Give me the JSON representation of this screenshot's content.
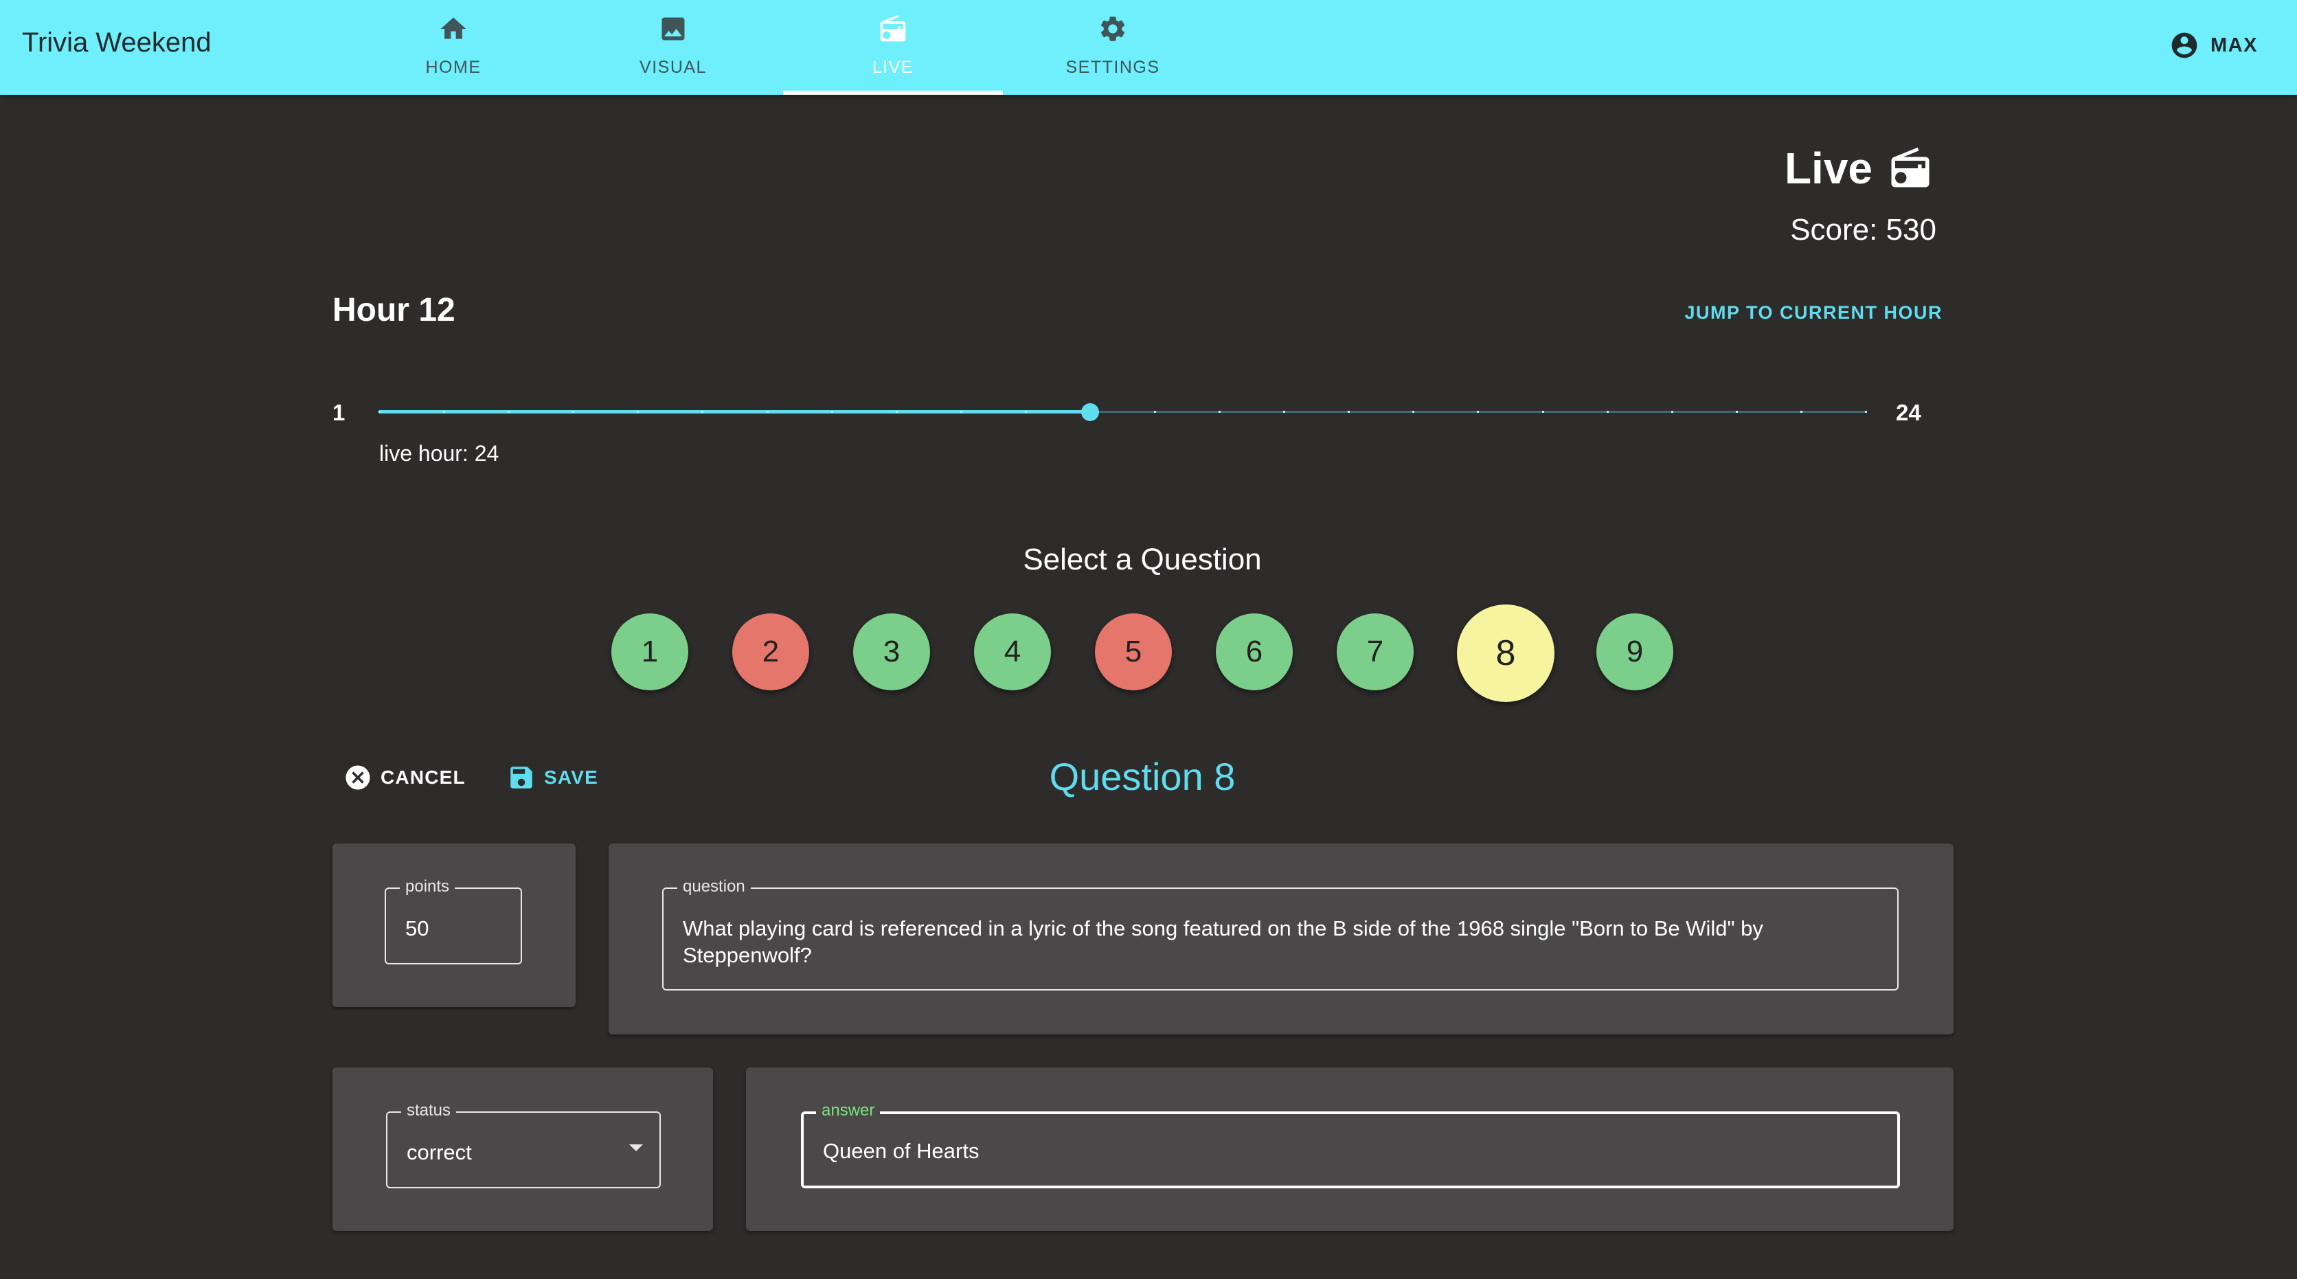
{
  "app": {
    "title": "Trivia Weekend"
  },
  "nav": {
    "tabs": [
      {
        "label": "HOME",
        "icon": "home-icon"
      },
      {
        "label": "VISUAL",
        "icon": "image-icon"
      },
      {
        "label": "LIVE",
        "icon": "radio-icon",
        "active": true
      },
      {
        "label": "SETTINGS",
        "icon": "gear-icon"
      }
    ],
    "user": {
      "label": "MAX",
      "icon": "account-circle-icon"
    }
  },
  "live": {
    "title": "Live",
    "icon": "radio-icon",
    "score_text": "Score: 530"
  },
  "hour": {
    "title": "Hour 12",
    "jump_label": "JUMP TO CURRENT HOUR",
    "slider": {
      "min_label": "1",
      "max_label": "24",
      "min": 1,
      "max": 24,
      "value": 12
    },
    "live_hour_note": "live hour: 24"
  },
  "questions": {
    "title": "Select a Question",
    "items": [
      {
        "label": "1",
        "status": "correct"
      },
      {
        "label": "2",
        "status": "incorrect"
      },
      {
        "label": "3",
        "status": "correct"
      },
      {
        "label": "4",
        "status": "correct"
      },
      {
        "label": "5",
        "status": "incorrect"
      },
      {
        "label": "6",
        "status": "correct"
      },
      {
        "label": "7",
        "status": "correct"
      },
      {
        "label": "8",
        "status": "selected"
      },
      {
        "label": "9",
        "status": "correct"
      }
    ]
  },
  "editor": {
    "cancel_label": "CANCEL",
    "save_label": "SAVE",
    "heading": "Question 8",
    "points": {
      "label": "points",
      "value": "50"
    },
    "question": {
      "label": "question",
      "value": "What playing card is referenced in a lyric of the song featured on the B side of the 1968 single \"Born to Be Wild\" by Steppenwolf?"
    },
    "status": {
      "label": "status",
      "value": "correct"
    },
    "answer": {
      "label": "answer",
      "value": "Queen of Hearts"
    }
  },
  "colors": {
    "appbar": "#6eeffb",
    "background": "#2e2b2b",
    "accent": "#5fdcee",
    "correct": "#7ccf8a",
    "incorrect": "#e5766b",
    "selected": "#f7f4a0",
    "card": "#4a4848"
  }
}
